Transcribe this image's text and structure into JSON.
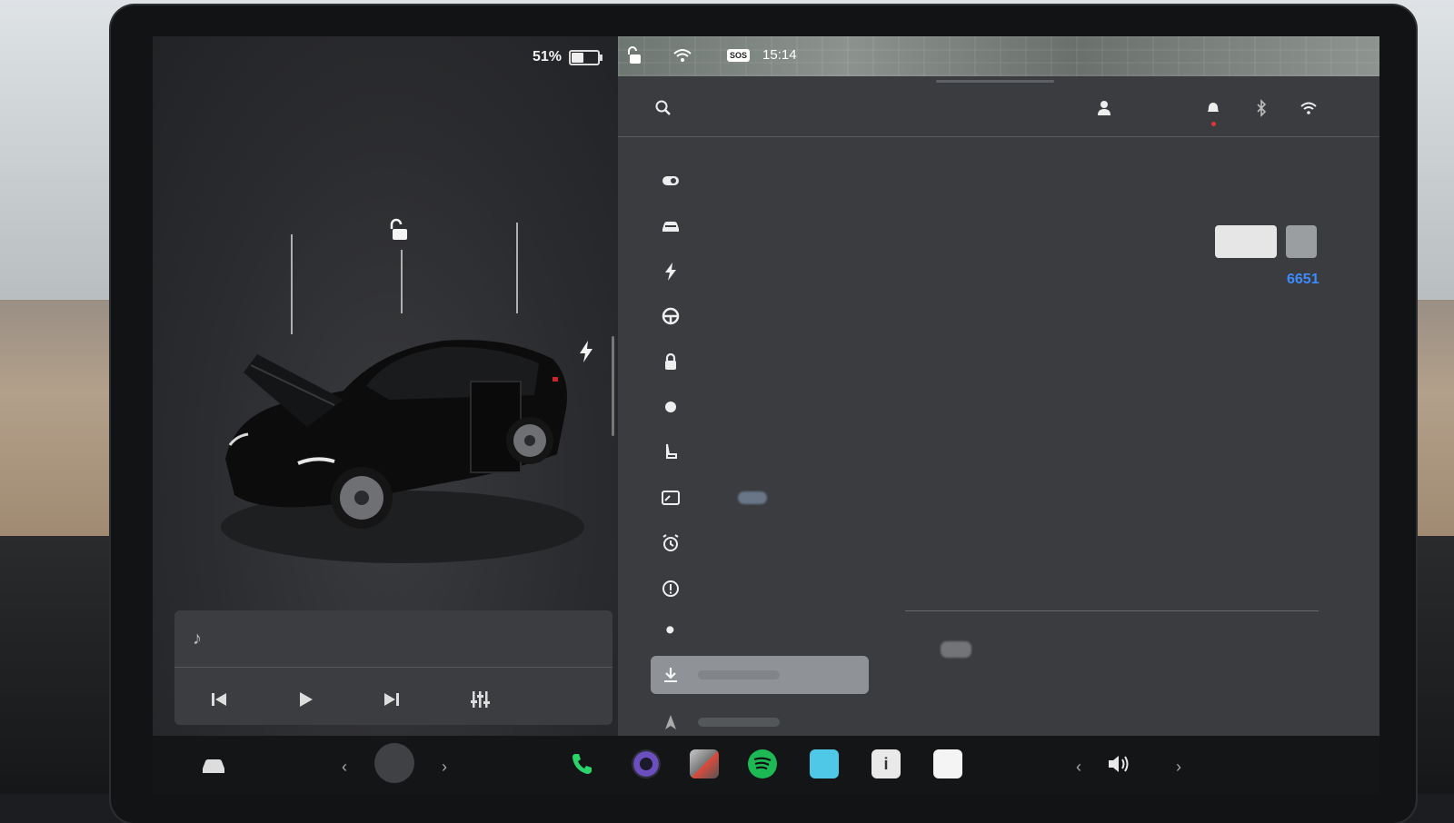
{
  "status_bar": {
    "battery_percent": "51%",
    "battery_level": 0.51,
    "time": "15:14",
    "sos_label": "SOS"
  },
  "controls": {
    "version_number": "6651"
  },
  "sidebar": {
    "items": [
      {
        "icon": "toggle-icon"
      },
      {
        "icon": "car-icon"
      },
      {
        "icon": "bolt-icon"
      },
      {
        "icon": "steering-wheel-icon"
      },
      {
        "icon": "lock-icon"
      },
      {
        "icon": "light-icon"
      },
      {
        "icon": "seat-icon"
      },
      {
        "icon": "display-icon"
      },
      {
        "icon": "alarm-clock-icon"
      },
      {
        "icon": "alert-icon"
      },
      {
        "icon": "wrench-icon"
      },
      {
        "icon": "download-icon",
        "selected": true
      },
      {
        "icon": "navigate-icon"
      }
    ]
  },
  "dock": {
    "apps": [
      "phone-icon",
      "camera-icon",
      "toybox-icon",
      "spotify-icon",
      "bluetooth-app-icon",
      "info-icon",
      "notes-icon"
    ]
  },
  "colors": {
    "accent_blue": "#3d8bff",
    "spotify_green": "#1db954",
    "phone_green": "#2bd46a"
  }
}
